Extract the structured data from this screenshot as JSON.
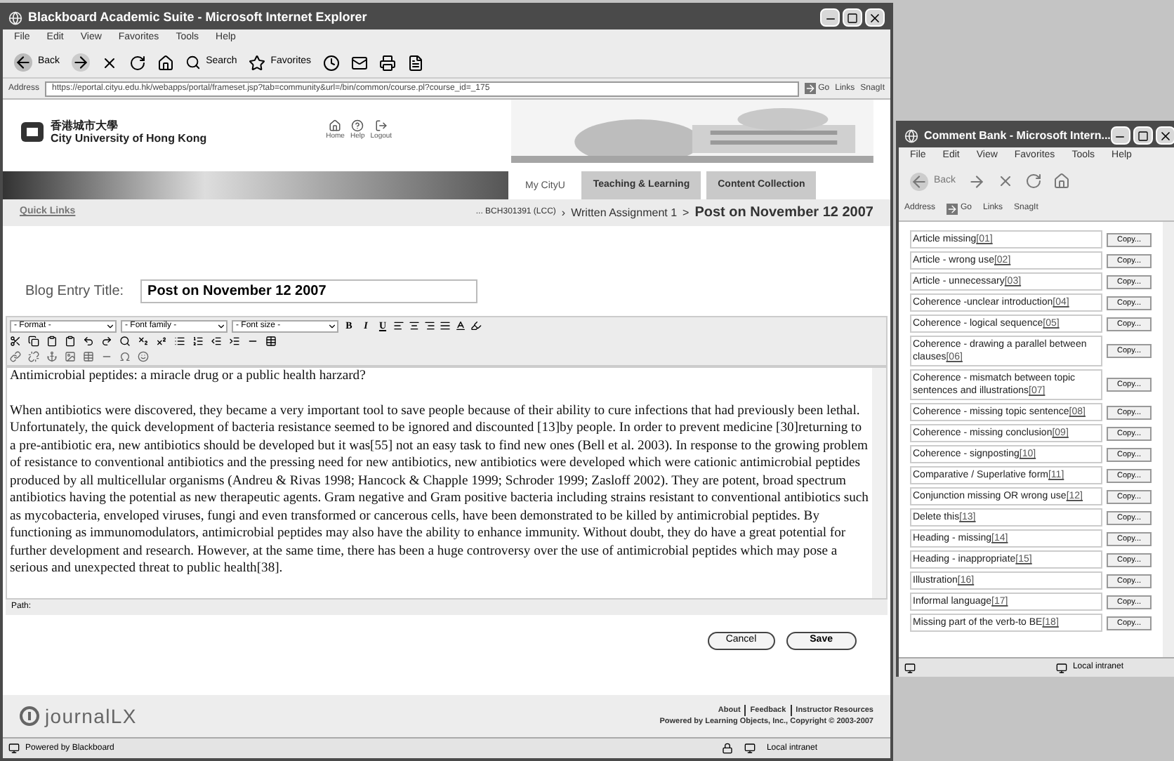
{
  "main_window": {
    "title": "Blackboard Academic Suite - Microsoft Internet Explorer",
    "menu": [
      "File",
      "Edit",
      "View",
      "Favorites",
      "Tools",
      "Help"
    ],
    "toolbar": {
      "back": "Back",
      "search": "Search",
      "favorites": "Favorites"
    },
    "address": {
      "label": "Address",
      "url": "https://eportal.cityu.edu.hk/webapps/portal/frameset.jsp?tab=community&url=/bin/common/course.pl?course_id=_175",
      "go": "Go",
      "links": "Links",
      "snagit": "SnagIt"
    },
    "header": {
      "logo_chinese": "香港城市大學",
      "logo_english": "City University of Hong Kong",
      "nav": [
        "Home",
        "Help",
        "Logout"
      ]
    },
    "tabs": [
      {
        "label": "My CityU",
        "selected": true
      },
      {
        "label": "Teaching & Learning",
        "selected": false
      },
      {
        "label": "Content Collection",
        "selected": false
      }
    ],
    "quick_links": "Quick Links",
    "breadcrumb": [
      {
        "text": "... BCH301391 (LCC)",
        "separator": "›",
        "current": false
      },
      {
        "text": "Written Assignment 1",
        "separator": ">",
        "current": false
      },
      {
        "text": "Post on November 12 2007",
        "current": true
      }
    ],
    "blog_title": {
      "label": "Blog Entry Title:",
      "value": "Post on November 12 2007"
    },
    "editor": {
      "selects": [
        "- Format -",
        "- Font family -",
        "- Font size -"
      ],
      "style_buttons": [
        "B",
        "I",
        "U"
      ],
      "heading": "Antimicrobial peptides: a miracle drug or a public health harzard?",
      "body": "When antibiotics were discovered, they became a very important tool to save people because of their ability to cure infections that had previously been lethal. Unfortunately, the quick development of bacteria resistance seemed to be ignored and discounted [13]by people. In order to prevent medicine [30]returning to a pre-antibiotic era, new antibiotics should be developed but it was[55] not an easy task to find new ones (Bell et al. 2003). In response to the growing problem of resistance to conventional antibiotics and the pressing need for new antibiotics, new antibiotics were developed which were cationic antimicrobial peptides produced by all multicellular organisms (Andreu & Rivas 1998; Hancock & Chapple 1999; Schroder 1999; Zasloff 2002). They are potent, broad spectrum antibiotics having the potential as new therapeutic agents. Gram negative and Gram positive bacteria including strains resistant to conventional antibiotics such as mycobacteria, enveloped viruses, fungi and even transformed or cancerous cells, have been demonstrated to be killed by antimicrobial peptides. By functioning as immunomodulators, antimicrobial peptides may also have the ability to enhance immunity. Without doubt, they do have a great potential for further development and research. However, at the same time, there has been a huge controversy over the use of antimicrobial peptides which may pose a serious and unexpected threat to public health[38].",
      "path_label": "Path:"
    },
    "buttons": [
      "Cancel",
      "Save"
    ],
    "footer": {
      "logo": "journalLX",
      "links": [
        "About",
        "Feedback",
        "Instructor Resources"
      ],
      "copyright": "Powered by Learning Objects, Inc., Copyright © 2003-2007"
    },
    "status_bar": {
      "text": "Powered by Blackboard",
      "zone": "Local intranet"
    }
  },
  "comment_window": {
    "title": "Comment Bank - Microsoft Intern...",
    "menu": [
      "File",
      "Edit",
      "View",
      "Favorites",
      "Tools",
      "Help"
    ],
    "back": "Back",
    "address": "Address",
    "go": "Go",
    "links": "Links",
    "snagit": "SnagIt",
    "comments": [
      {
        "label": "Article missing",
        "code": "[01]",
        "copy": "Copy..."
      },
      {
        "label": "Article - wrong use",
        "code": "[02]",
        "copy": "Copy..."
      },
      {
        "label": "Article - unnecessary",
        "code": "[03]",
        "copy": "Copy..."
      },
      {
        "label": "Coherence -unclear introduction",
        "code": "[04]",
        "copy": "Copy..."
      },
      {
        "label": "Coherence - logical sequence",
        "code": "[05]",
        "copy": "Copy..."
      },
      {
        "label": "Coherence - drawing a parallel between clauses",
        "code": "[06]",
        "copy": "Copy..."
      },
      {
        "label": "Coherence - mismatch between topic sentences and illustrations",
        "code": "[07]",
        "copy": "Copy..."
      },
      {
        "label": "Coherence - missing topic sentence",
        "code": "[08]",
        "copy": "Copy..."
      },
      {
        "label": "Coherence - missing conclusion",
        "code": "[09]",
        "copy": "Copy..."
      },
      {
        "label": "Coherence - signposting",
        "code": "[10]",
        "copy": "Copy..."
      },
      {
        "label": "Comparative / Superlative form",
        "code": "[11]",
        "copy": "Copy..."
      },
      {
        "label": "Conjunction missing OR wrong use",
        "code": "[12]",
        "copy": "Copy..."
      },
      {
        "label": "Delete this",
        "code": "[13]",
        "copy": "Copy..."
      },
      {
        "label": "Heading - missing",
        "code": "[14]",
        "copy": "Copy..."
      },
      {
        "label": "Heading - inappropriate",
        "code": "[15]",
        "copy": "Copy..."
      },
      {
        "label": "Illustration",
        "code": "[16]",
        "copy": "Copy..."
      },
      {
        "label": "Informal language",
        "code": "[17]",
        "copy": "Copy..."
      },
      {
        "label": "Missing part of the verb-to BE",
        "code": "[18]",
        "copy": "Copy..."
      }
    ],
    "status_zone": "Local intranet"
  }
}
